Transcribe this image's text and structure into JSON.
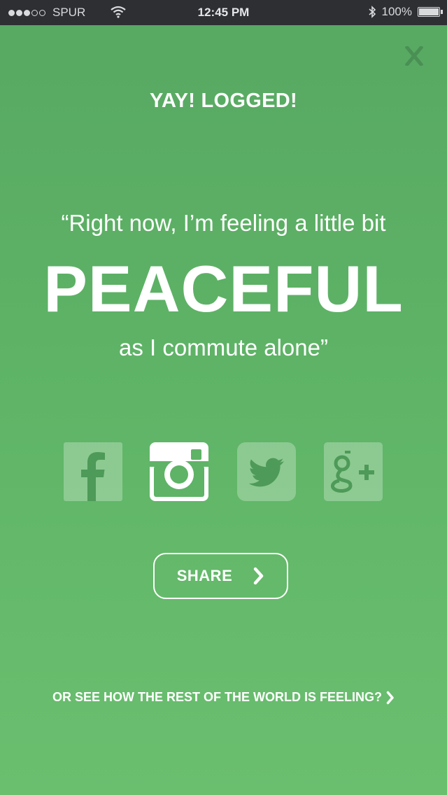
{
  "status_bar": {
    "carrier": "SPUR",
    "signal_bars_filled": 3,
    "signal_bars_total": 5,
    "time": "12:45 PM",
    "battery": "100%"
  },
  "icons": {
    "close": "close-x-icon",
    "wifi": "wifi-icon",
    "bluetooth": "bluetooth-icon",
    "battery": "battery-icon",
    "facebook": "facebook-icon",
    "instagram": "instagram-icon",
    "twitter": "twitter-icon",
    "googleplus": "googleplus-icon",
    "chevron": "chevron-right-icon"
  },
  "header": {
    "close_label": "X",
    "title": "YAY! LOGGED!"
  },
  "message": {
    "line1": "“Right now, I’m feeling a little bit",
    "mood": "PEACEFUL",
    "line3": "as I commute alone”"
  },
  "social": {
    "selected": "instagram"
  },
  "share": {
    "label": "SHARE"
  },
  "footer": {
    "world_link": "OR SEE HOW THE REST OF THE WORLD IS FEELING?"
  },
  "colors": {
    "background_top": "#57a862",
    "background_bottom": "#6abf6f",
    "status_bar": "#2d2f33",
    "close_icon": "#4a8f54",
    "text": "#ffffff"
  }
}
